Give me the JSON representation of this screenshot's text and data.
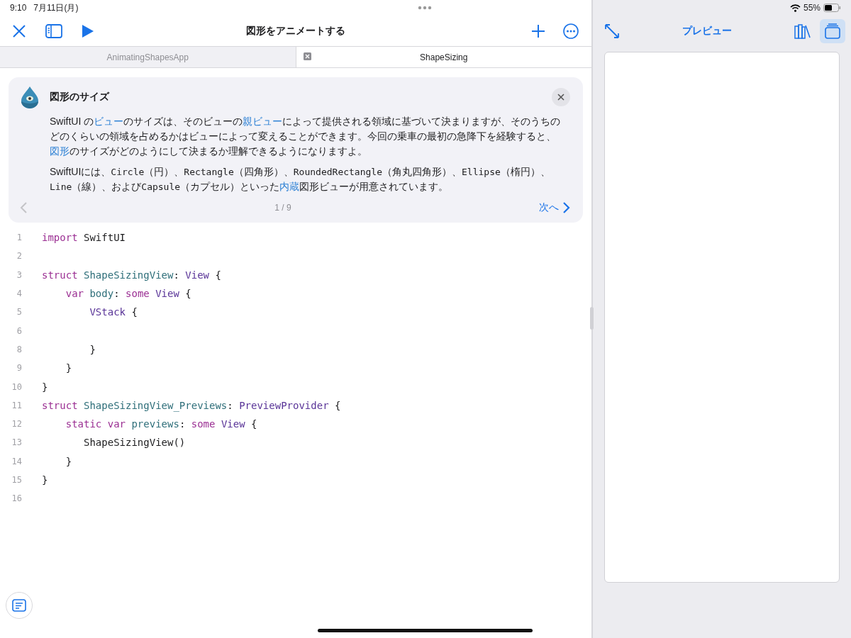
{
  "status_bar": {
    "time": "9:10",
    "date": "7月11日(月)",
    "battery": "55%"
  },
  "toolbar": {
    "title": "図形をアニメートする"
  },
  "tabs": [
    {
      "label": "AnimatingShapesApp",
      "selected": false
    },
    {
      "label": "ShapeSizing",
      "selected": true
    }
  ],
  "guide": {
    "title": "図形のサイズ",
    "paragraphs": [
      [
        {
          "kind": "text",
          "text": "SwiftUI の"
        },
        {
          "kind": "link",
          "text": "ビュー"
        },
        {
          "kind": "text",
          "text": "のサイズは、そのビューの"
        },
        {
          "kind": "link",
          "text": "親ビュー"
        },
        {
          "kind": "text",
          "text": "によって提供される領域に基づいて決まりますが、そのうちのどのくらいの領域を占めるかはビューによって変えることができます。今回の乗車の最初の急降下を経験すると、"
        },
        {
          "kind": "link",
          "text": "図形"
        },
        {
          "kind": "text",
          "text": "のサイズがどのようにして決まるか理解できるようになりますよ。"
        }
      ],
      [
        {
          "kind": "text",
          "text": "SwiftUIには、"
        },
        {
          "kind": "code",
          "text": "Circle"
        },
        {
          "kind": "text",
          "text": "（円）、"
        },
        {
          "kind": "code",
          "text": "Rectangle"
        },
        {
          "kind": "text",
          "text": "（四角形）、"
        },
        {
          "kind": "code",
          "text": "RoundedRectangle"
        },
        {
          "kind": "text",
          "text": "（角丸四角形）、"
        },
        {
          "kind": "code",
          "text": "Ellipse"
        },
        {
          "kind": "text",
          "text": "（楕円）、"
        },
        {
          "kind": "code",
          "text": "Line"
        },
        {
          "kind": "text",
          "text": "（線）、および"
        },
        {
          "kind": "code",
          "text": "Capsule"
        },
        {
          "kind": "text",
          "text": "（カプセル）といった"
        },
        {
          "kind": "link",
          "text": "内蔵"
        },
        {
          "kind": "text",
          "text": "図形ビューが用意されています。"
        }
      ]
    ],
    "page": "1 / 9",
    "next": "次へ"
  },
  "code": [
    {
      "number": "1",
      "tokens": [
        {
          "kind": "keyword",
          "text": "import"
        },
        {
          "kind": "plain",
          "text": " SwiftUI"
        }
      ]
    },
    {
      "number": "2"
    },
    {
      "number": "3",
      "tokens": [
        {
          "kind": "keyword",
          "text": "struct"
        },
        {
          "kind": "decl",
          "text": " ShapeSizingView"
        },
        {
          "kind": "plain",
          "text": ": "
        },
        {
          "kind": "type",
          "text": "View"
        },
        {
          "kind": "plain",
          "text": " {"
        }
      ]
    },
    {
      "number": "4",
      "tokens": [
        {
          "kind": "keyword",
          "text": "    var"
        },
        {
          "kind": "decl",
          "text": " body"
        },
        {
          "kind": "plain",
          "text": ": "
        },
        {
          "kind": "keyword",
          "text": "some"
        },
        {
          "kind": "type",
          "text": " View"
        },
        {
          "kind": "plain",
          "text": " {"
        }
      ]
    },
    {
      "number": "5",
      "tokens": [
        {
          "kind": "type",
          "text": "        VStack"
        },
        {
          "kind": "plain",
          "text": " {"
        }
      ]
    },
    {
      "number": "6"
    },
    {
      "number": "8",
      "tokens": [
        {
          "kind": "plain",
          "text": "        }"
        }
      ]
    },
    {
      "number": "9",
      "tokens": [
        {
          "kind": "plain",
          "text": "    }"
        }
      ]
    },
    {
      "number": "10",
      "tokens": [
        {
          "kind": "plain",
          "text": "}"
        }
      ]
    },
    {
      "number": "11",
      "tokens": [
        {
          "kind": "keyword",
          "text": "struct"
        },
        {
          "kind": "decl",
          "text": " ShapeSizingView_Previews"
        },
        {
          "kind": "plain",
          "text": ": "
        },
        {
          "kind": "type",
          "text": "PreviewProvider"
        },
        {
          "kind": "plain",
          "text": " {"
        }
      ]
    },
    {
      "number": "12",
      "tokens": [
        {
          "kind": "keyword",
          "text": "    static var"
        },
        {
          "kind": "decl",
          "text": " previews"
        },
        {
          "kind": "plain",
          "text": ": "
        },
        {
          "kind": "keyword",
          "text": "some"
        },
        {
          "kind": "type",
          "text": " View"
        },
        {
          "kind": "plain",
          "text": " {"
        }
      ]
    },
    {
      "number": "13",
      "tokens": [
        {
          "kind": "plain",
          "text": "       ShapeSizingView()"
        }
      ]
    },
    {
      "number": "14",
      "tokens": [
        {
          "kind": "plain",
          "text": "    }"
        }
      ]
    },
    {
      "number": "15",
      "tokens": [
        {
          "kind": "plain",
          "text": "}"
        }
      ]
    },
    {
      "number": "16"
    }
  ],
  "preview": {
    "title": "プレビュー",
    "panel_selected": true
  }
}
